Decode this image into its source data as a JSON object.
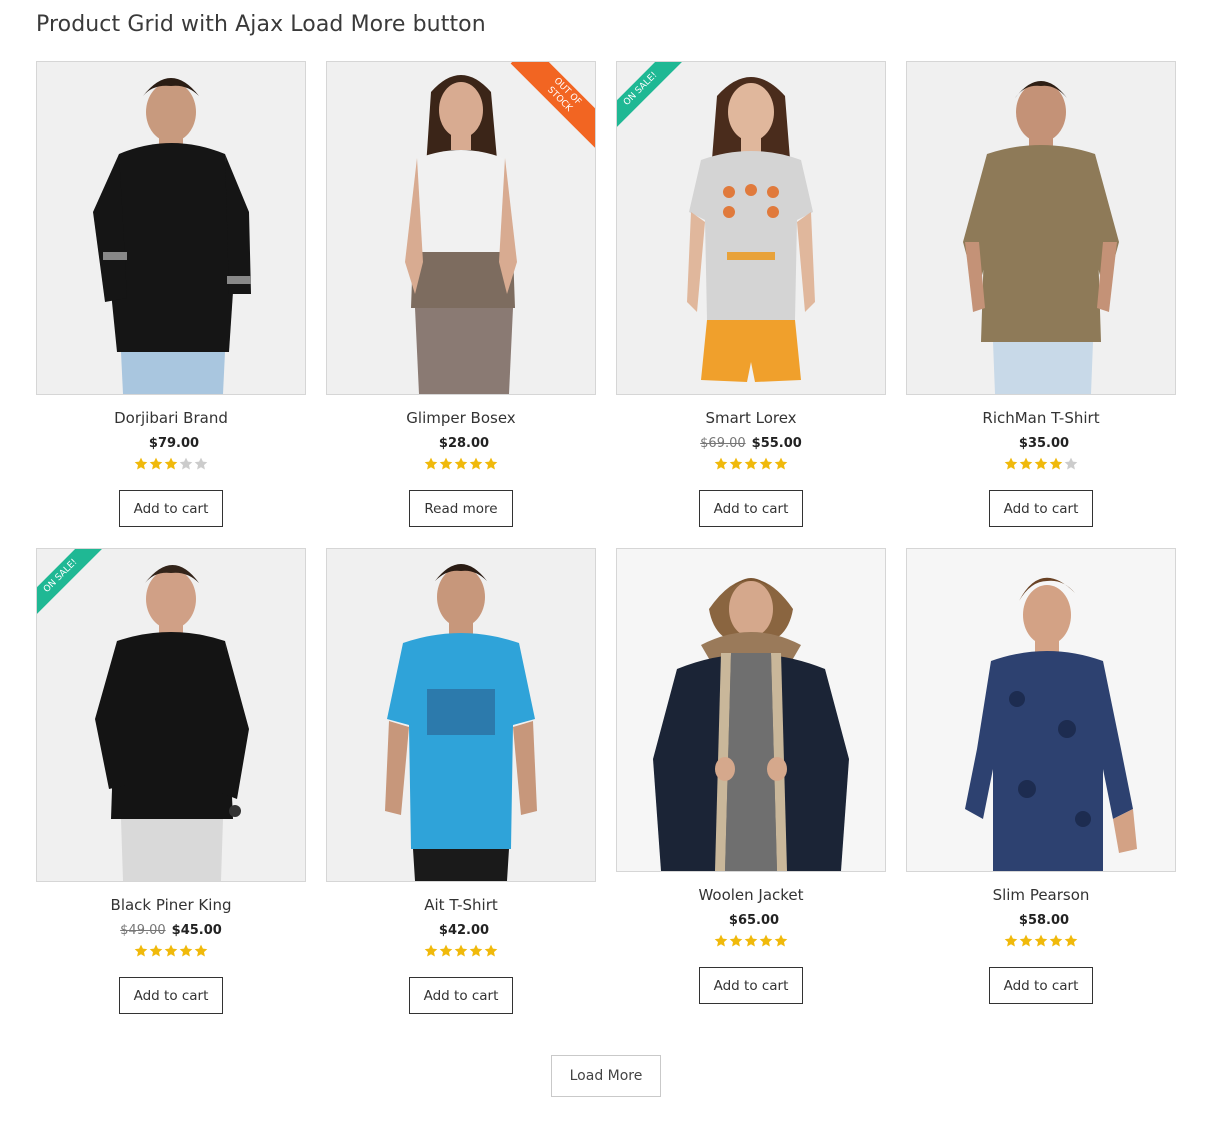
{
  "page": {
    "heading": "Product Grid with Ajax Load More button"
  },
  "colors": {
    "star": "#f0b90b",
    "star_empty": "#cccccc",
    "badge_out_of_stock": "#f26522",
    "badge_sale": "#1fb894"
  },
  "products": [
    {
      "name": "Dorjibari Brand",
      "price": "$79.00",
      "old_price": "",
      "rating": 3,
      "button": "Add to cart",
      "badge": "",
      "image": "man-black-shirt"
    },
    {
      "name": "Glimper Bosex",
      "price": "$28.00",
      "old_price": "",
      "rating": 5,
      "button": "Read more",
      "badge": "OUT OF\nSTOCK",
      "image": "woman-sleeveless-top"
    },
    {
      "name": "Smart Lorex",
      "price": "$55.00",
      "old_price": "$69.00",
      "rating": 5,
      "button": "Add to cart",
      "badge": "ON SALE!",
      "image": "woman-grey-tshirt"
    },
    {
      "name": "RichMan T-Shirt",
      "price": "$35.00",
      "old_price": "",
      "rating": 4,
      "button": "Add to cart",
      "badge": "",
      "image": "man-khaki-shirt"
    },
    {
      "name": "Black Piner King",
      "price": "$45.00",
      "old_price": "$49.00",
      "rating": 5,
      "button": "Add to cart",
      "badge": "ON SALE!",
      "image": "man-black-shirt-2"
    },
    {
      "name": "Ait T-Shirt",
      "price": "$42.00",
      "old_price": "",
      "rating": 5,
      "button": "Add to cart",
      "badge": "",
      "image": "man-blue-tshirt"
    },
    {
      "name": "Woolen Jacket",
      "price": "$65.00",
      "old_price": "",
      "rating": 5,
      "button": "Add to cart",
      "badge": "",
      "image": "man-winter-jacket"
    },
    {
      "name": "Slim Pearson",
      "price": "$58.00",
      "old_price": "",
      "rating": 5,
      "button": "Add to cart",
      "badge": "",
      "image": "man-floral-shirt"
    }
  ],
  "load_more": {
    "label": "Load More"
  }
}
